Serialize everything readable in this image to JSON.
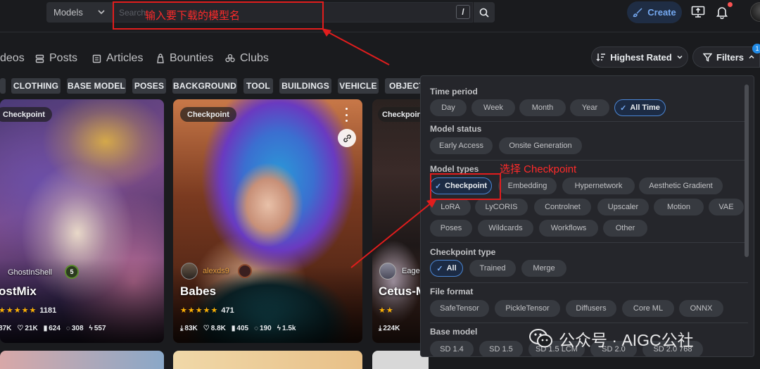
{
  "header": {
    "models_label": "Models",
    "search_placeholder": "Search",
    "slash_key": "/",
    "create_label": "Create",
    "annotation_search": "输入要下载的模型名"
  },
  "nav": {
    "items": [
      {
        "label": "deos",
        "icon": "video-icon"
      },
      {
        "label": "Posts",
        "icon": "posts-icon"
      },
      {
        "label": "Articles",
        "icon": "articles-icon"
      },
      {
        "label": "Bounties",
        "icon": "bounties-icon"
      },
      {
        "label": "Clubs",
        "icon": "clubs-icon"
      }
    ],
    "sort_label": "Highest Rated",
    "filters_label": "Filters",
    "filters_count": "1"
  },
  "tags": [
    "CLOTHING",
    "BASE MODEL",
    "POSES",
    "BACKGROUND",
    "TOOL",
    "BUILDINGS",
    "VEHICLE",
    "OBJECTS"
  ],
  "cards": [
    {
      "badge": "Checkpoint",
      "title": "ostMix",
      "user": "GhostInShell",
      "level": "5",
      "rating_count": "1181",
      "stats": {
        "downloads": "87K",
        "likes": "21K",
        "collects": "624",
        "comments": "308",
        "tips": "557"
      }
    },
    {
      "badge": "Checkpoint",
      "title": "Babes",
      "user": "alexds9",
      "rating_count": "471",
      "stats": {
        "downloads": "83K",
        "likes": "8.8K",
        "collects": "405",
        "comments": "190",
        "tips": "1.5k"
      }
    },
    {
      "badge": "Checkpoint",
      "title": "Cetus-M",
      "user": "Eagel",
      "stats": {
        "downloads": "224K"
      }
    }
  ],
  "filters": {
    "time_period": {
      "title": "Time period",
      "options": [
        "Day",
        "Week",
        "Month",
        "Year",
        "All Time"
      ],
      "selected": "All Time"
    },
    "model_status": {
      "title": "Model status",
      "options": [
        "Early Access",
        "Onsite Generation"
      ]
    },
    "model_types": {
      "title": "Model types",
      "options": [
        "Checkpoint",
        "Embedding",
        "Hypernetwork",
        "Aesthetic Gradient",
        "LoRA",
        "LyCORIS",
        "Controlnet",
        "Upscaler",
        "Motion",
        "VAE",
        "Poses",
        "Wildcards",
        "Workflows",
        "Other"
      ],
      "selected": "Checkpoint"
    },
    "checkpoint_type": {
      "title": "Checkpoint type",
      "options": [
        "All",
        "Trained",
        "Merge"
      ],
      "selected": "All"
    },
    "file_format": {
      "title": "File format",
      "options": [
        "SafeTensor",
        "PickleTensor",
        "Diffusers",
        "Core ML",
        "ONNX"
      ]
    },
    "base_model": {
      "title": "Base model",
      "options": [
        "SD 1.4",
        "SD 1.5",
        "SD 1.5 LCM",
        "SD 2.0",
        "SD 2.0 768"
      ]
    },
    "annotation_checkpoint": "选择 Checkpoint"
  },
  "watermark": "公众号 · AIGC公社",
  "colors": {
    "accent": "#228be6",
    "annotation": "#e11d1d",
    "star": "#fab005",
    "panel": "#25262b"
  }
}
